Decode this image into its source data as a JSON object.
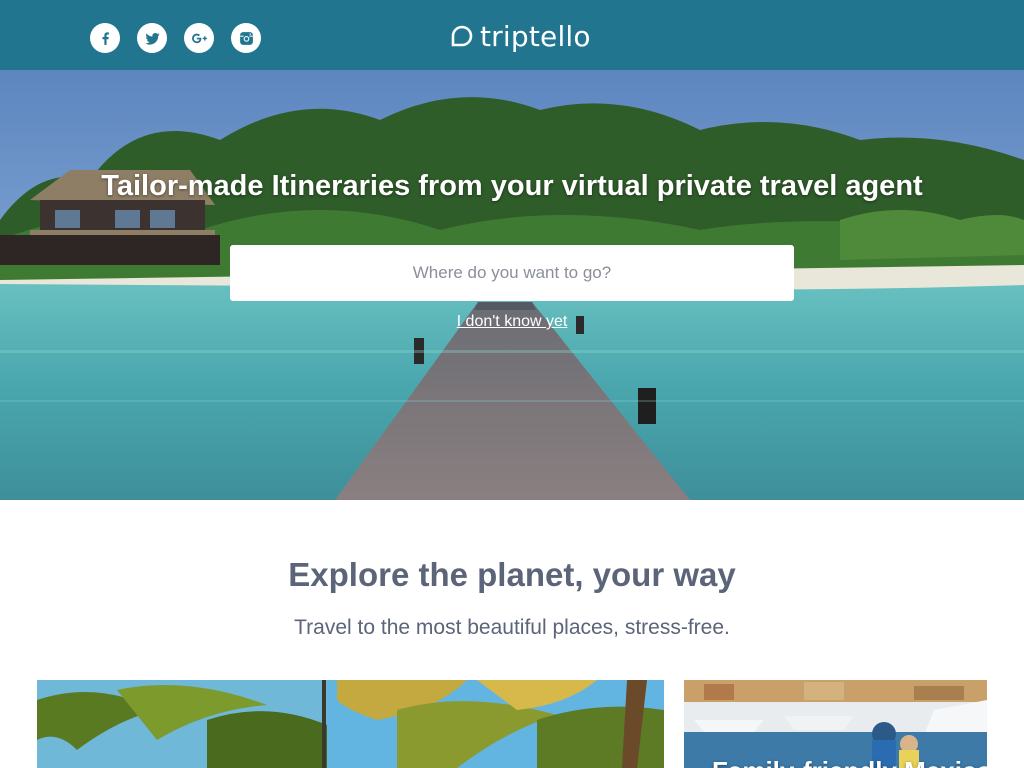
{
  "header": {
    "brand": "triptello",
    "social": [
      {
        "name": "facebook-icon"
      },
      {
        "name": "twitter-icon"
      },
      {
        "name": "google-plus-icon"
      },
      {
        "name": "instagram-icon"
      }
    ],
    "bar_color": "#21758f"
  },
  "hero": {
    "title": "Tailor-made Itineraries from your virtual private travel agent",
    "search_placeholder": "Where do you want to go?",
    "dont_know_link": "I don't know yet"
  },
  "explore": {
    "title": "Explore the planet, your way",
    "subtitle": "Travel to the most beautiful places, stress-free."
  },
  "cards": [
    {
      "label": ""
    },
    {
      "label": "Family-friendly Mexico"
    }
  ],
  "colors": {
    "text": "#5b6478",
    "white": "#ffffff"
  }
}
